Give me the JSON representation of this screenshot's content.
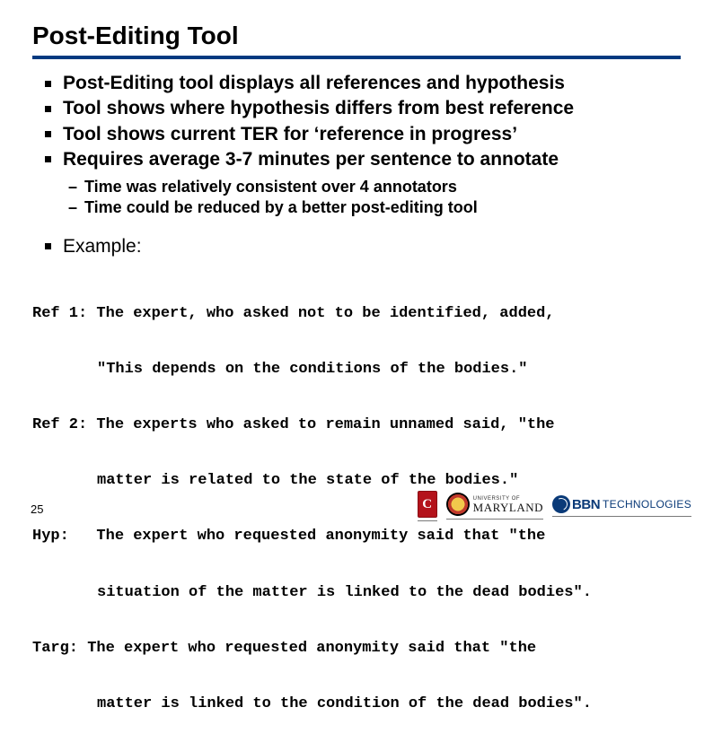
{
  "title": "Post-Editing Tool",
  "bullets": [
    "Post-Editing tool displays all references and hypothesis",
    "Tool shows where hypothesis differs from best reference",
    "Tool shows current TER for ‘reference in progress’",
    "Requires average 3-7 minutes per sentence to annotate"
  ],
  "sub_bullets": [
    "Time was relatively consistent over 4 annotators",
    "Time could be reduced by a better post-editing tool"
  ],
  "example_label": "Example:",
  "example": {
    "ref1_l1": "Ref 1: The expert, who asked not to be identified, added,",
    "ref1_l2": "\"This depends on the conditions of the bodies.\"",
    "ref2_l1": "Ref 2: The experts who asked to remain unnamed said, \"the",
    "ref2_l2": "matter is related to the state of the bodies.\"",
    "hyp_l1": "Hyp:   The expert who requested anonymity said that \"the",
    "hyp_l2": "situation of the matter is linked to the dead bodies\".",
    "targ_l1": "Targ: The expert who requested anonymity said that \"the",
    "targ_l2": "matter is linked to the condition of the dead bodies\"."
  },
  "page_number": "25",
  "logos": {
    "cu_letter": "C",
    "umd_small": "UNIVERSITY OF",
    "umd_big": "MARYLAND",
    "bbn_bold": "BBN",
    "bbn_rest": "TECHNOLOGIES"
  }
}
